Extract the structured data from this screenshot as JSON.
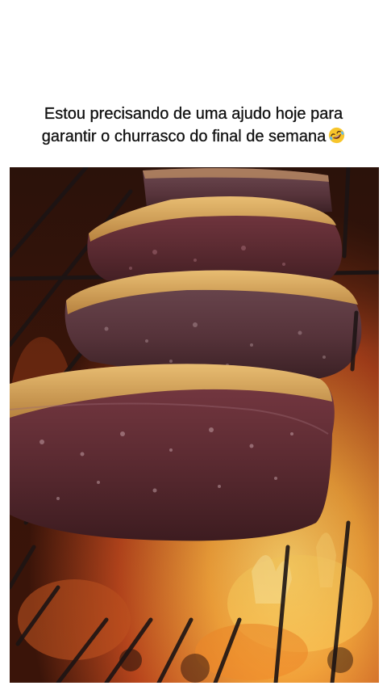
{
  "post": {
    "caption_line_1": "Estou precisando de uma ajudo hoje para",
    "caption_line_2": "garantir o churrasco do final de semana",
    "caption_emoji": "rolling-on-the-floor-laughing-emoji"
  },
  "photo": {
    "subject": "grilled-picanha-on-grill",
    "colors": {
      "fire": "#f2a23a",
      "ember": "#b8451c",
      "meat": "#5e2c33",
      "fat": "#d9a45a",
      "grill": "#1c1414"
    }
  }
}
